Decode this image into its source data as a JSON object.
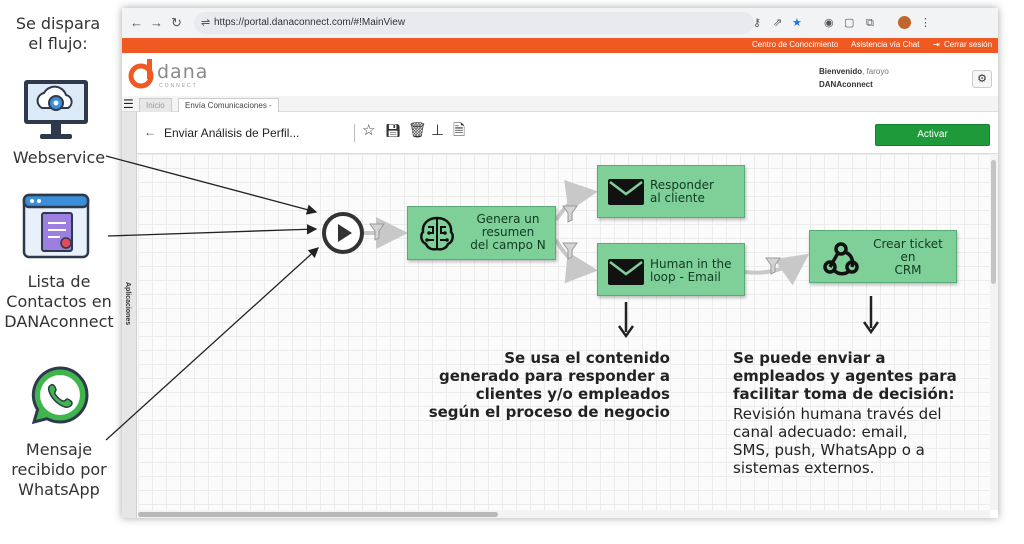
{
  "left_panel": {
    "heading": [
      "Se dispara",
      "el flujo:"
    ],
    "webservice_label": "Webservice",
    "contacts_label": [
      "Lista de",
      "Contactos en",
      "DANAconnect"
    ],
    "whatsapp_label": [
      "Mensaje",
      "recibido por",
      "WhatsApp"
    ]
  },
  "browser": {
    "url": "https://portal.danaconnect.com/#!MainView"
  },
  "topbar": {
    "links": [
      "Centro de Conocimiento",
      "Asistencia vía Chat",
      "Cerrar sesión"
    ],
    "color": "#f05a22"
  },
  "header": {
    "logo_text": "dana",
    "logo_sub": "CONNECT",
    "welcome": "Bienvenido",
    "username": ", faroyo",
    "company": "DANAconnect"
  },
  "tabs": [
    "Inicio",
    "Envía Comunicaciones -"
  ],
  "sidebar": {
    "label": "Aplicaciones"
  },
  "toolbar": {
    "title": "Enviar Análisis de Perfil...",
    "activate_label": "Activar",
    "activate_color": "#1e9a3a"
  },
  "flow": {
    "node_color": "#7fcf99",
    "nodes": {
      "summary": [
        "Genera un",
        "resumen",
        "del campo N"
      ],
      "reply": [
        "Responder",
        "al cliente"
      ],
      "human": [
        "Human in the",
        "loop - Email"
      ],
      "ticket": [
        "Crear ticket",
        "en",
        "CRM"
      ]
    }
  },
  "annotations": {
    "left_bold": [
      "Se usa el contenido",
      "generado para responder a",
      "clientes y/o empleados",
      "según el proceso de negocio"
    ],
    "right_bold": [
      "Se puede enviar a",
      "empleados y agentes para",
      "facilitar toma de decisión:"
    ],
    "right_normal": [
      "Revisión humana través del",
      "canal adecuado: email,",
      "SMS, push, WhatsApp o a",
      "sistemas externos."
    ]
  }
}
